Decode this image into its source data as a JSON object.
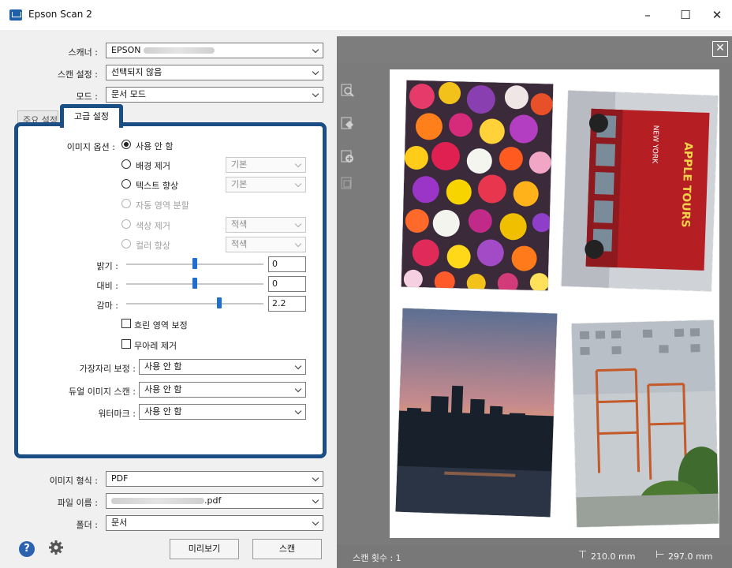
{
  "window": {
    "title": "Epson Scan 2",
    "controls": {
      "minimize": "–",
      "maximize": "☐",
      "close": "✕"
    }
  },
  "settings": {
    "scanner_label": "스캐너 :",
    "scanner_value": "EPSON",
    "scan_setting_label": "스캔 설정 :",
    "scan_setting_value": "선택되지 않음",
    "mode_label": "모드 :",
    "mode_value": "문서 모드"
  },
  "tabs": {
    "main": "주요 설정",
    "advanced": "고급 설정"
  },
  "advanced": {
    "image_option_label": "이미지 옵션 :",
    "image_options": [
      {
        "label": "사용 안 함",
        "selected": true,
        "enabled": true
      },
      {
        "label": "배경 제거",
        "selected": false,
        "enabled": true,
        "select": "기본"
      },
      {
        "label": "텍스트 향상",
        "selected": false,
        "enabled": true,
        "select": "기본"
      },
      {
        "label": "자동 영역 분할",
        "selected": false,
        "enabled": false
      },
      {
        "label": "색상 제거",
        "selected": false,
        "enabled": false,
        "select": "적색"
      },
      {
        "label": "컬러 향상",
        "selected": false,
        "enabled": false,
        "select": "적색"
      }
    ],
    "brightness_label": "밝기 :",
    "brightness_value": "0",
    "brightness_level": 0.5,
    "contrast_label": "대비 :",
    "contrast_value": "0",
    "contrast_level": 0.5,
    "gamma_label": "감마 :",
    "gamma_value": "2.2",
    "gamma_level": 0.68,
    "unsharp_label": "흐린 영역 보정",
    "unsharp_checked": false,
    "descreen_label": "무아레 제거",
    "descreen_checked": false,
    "edge_fill_label": "가장자리 보정 :",
    "edge_fill_value": "사용 안 함",
    "dual_image_label": "듀얼 이미지 스캔 :",
    "dual_image_value": "사용 안 함",
    "watermark_label": "워터마크 :",
    "watermark_value": "사용 안 함"
  },
  "output": {
    "format_label": "이미지 형식 :",
    "format_value": "PDF",
    "filename_label": "파일 이름 :",
    "filename_suffix": ".pdf",
    "folder_label": "폴더 :",
    "folder_value": "문서"
  },
  "buttons": {
    "preview": "미리보기",
    "scan": "스캔"
  },
  "icons": {
    "help": "help-icon",
    "settings": "gear-icon"
  },
  "status": {
    "scan_count": "스캔 횟수 : 1",
    "width": "210.0 mm",
    "height": "297.0 mm"
  },
  "colors": {
    "accent": "#1c4e86",
    "slider": "#1e6fd0",
    "preview_bg": "#7b7b7b"
  }
}
